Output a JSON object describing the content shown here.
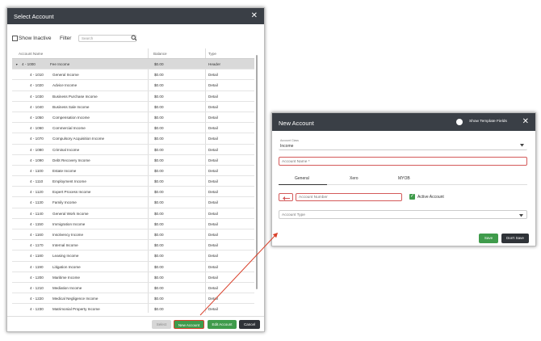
{
  "select_account": {
    "title": "Select Account",
    "close": "✕",
    "show_inactive": "Show Inactive",
    "filter_label": "Filter",
    "search_placeholder": "Search",
    "columns": [
      "Account Name",
      "Balance",
      "Type"
    ],
    "rows": [
      {
        "code": "4 - 1000",
        "name": "Fee Income",
        "balance": "$0.00",
        "type": "Header"
      },
      {
        "code": "4 - 1010",
        "name": "General Income",
        "balance": "$0.00",
        "type": "Detail"
      },
      {
        "code": "4 - 1020",
        "name": "Advice Income",
        "balance": "$0.00",
        "type": "Detail"
      },
      {
        "code": "4 - 1030",
        "name": "Business Purchase Income",
        "balance": "$0.00",
        "type": "Detail"
      },
      {
        "code": "4 - 1040",
        "name": "Business Sale Income",
        "balance": "$0.00",
        "type": "Detail"
      },
      {
        "code": "4 - 1050",
        "name": "Compensation Income",
        "balance": "$0.00",
        "type": "Detail"
      },
      {
        "code": "4 - 1060",
        "name": "Commercial Income",
        "balance": "$0.00",
        "type": "Detail"
      },
      {
        "code": "4 - 1070",
        "name": "Compulsory Acquisition Income",
        "balance": "$0.00",
        "type": "Detail"
      },
      {
        "code": "4 - 1080",
        "name": "Criminal Income",
        "balance": "$0.00",
        "type": "Detail"
      },
      {
        "code": "4 - 1090",
        "name": "Debt Recovery Income",
        "balance": "$0.00",
        "type": "Detail"
      },
      {
        "code": "4 - 1100",
        "name": "Estate Income",
        "balance": "$0.00",
        "type": "Detail"
      },
      {
        "code": "4 - 1110",
        "name": "Employment Income",
        "balance": "$0.00",
        "type": "Detail"
      },
      {
        "code": "4 - 1120",
        "name": "Expert Process Income",
        "balance": "$0.00",
        "type": "Detail"
      },
      {
        "code": "4 - 1130",
        "name": "Family Income",
        "balance": "$0.00",
        "type": "Detail"
      },
      {
        "code": "4 - 1140",
        "name": "General Work Income",
        "balance": "$0.00",
        "type": "Detail"
      },
      {
        "code": "4 - 1150",
        "name": "Immigration Income",
        "balance": "$0.00",
        "type": "Detail"
      },
      {
        "code": "4 - 1160",
        "name": "Insolvency Income",
        "balance": "$0.00",
        "type": "Detail"
      },
      {
        "code": "4 - 1170",
        "name": "Internal Income",
        "balance": "$0.00",
        "type": "Detail"
      },
      {
        "code": "4 - 1180",
        "name": "Leasing Income",
        "balance": "$0.00",
        "type": "Detail"
      },
      {
        "code": "4 - 1190",
        "name": "Litigation Income",
        "balance": "$0.00",
        "type": "Detail"
      },
      {
        "code": "4 - 1200",
        "name": "Maritime Income",
        "balance": "$0.00",
        "type": "Detail"
      },
      {
        "code": "4 - 1210",
        "name": "Mediation Income",
        "balance": "$0.00",
        "type": "Detail"
      },
      {
        "code": "4 - 1220",
        "name": "Medical Negligence Income",
        "balance": "$0.00",
        "type": "Detail"
      },
      {
        "code": "4 - 1230",
        "name": "Matrimonial Property Income",
        "balance": "$0.00",
        "type": "Detail"
      }
    ],
    "buttons": {
      "select": "Select",
      "new_account": "New Account",
      "edit_account": "Edit Account",
      "cancel": "Cancel"
    }
  },
  "new_account": {
    "title": "New Account",
    "show_template_fields": "Show Template Fields",
    "close": "✕",
    "account_class_label": "Account Class",
    "account_class_value": "Income",
    "account_name_placeholder": "Account Name *",
    "tabs": [
      "General",
      "Xero",
      "MYOB"
    ],
    "account_number_placeholder": "Account Number",
    "active_account": "Active Account",
    "account_type_placeholder": "Account Type",
    "buttons": {
      "save": "Save",
      "dont_save": "Don't Save"
    }
  },
  "colors": {
    "header": "#3a3f46",
    "green": "#3f9b4b",
    "dark_button": "#2f3338",
    "red": "#d9412b"
  }
}
